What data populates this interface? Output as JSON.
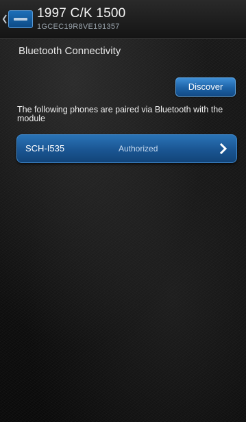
{
  "header": {
    "title": "1997 C/K 1500",
    "vin": "1GCEC19R8VE191357"
  },
  "icons": {
    "back": "chevron-left-icon",
    "logo": "vehicle-logo-icon",
    "row_arrow": "chevron-right-icon"
  },
  "section": {
    "title": "Bluetooth Connectivity"
  },
  "actions": {
    "discover_label": "Discover"
  },
  "paired": {
    "description": "The following phones are paired via Bluetooth with the module",
    "devices": [
      {
        "name": "SCH-I535",
        "status": "Authorized"
      }
    ]
  },
  "colors": {
    "accent_blue": "#1d62a6",
    "row_blue": "#1a5592",
    "background": "#121212"
  }
}
